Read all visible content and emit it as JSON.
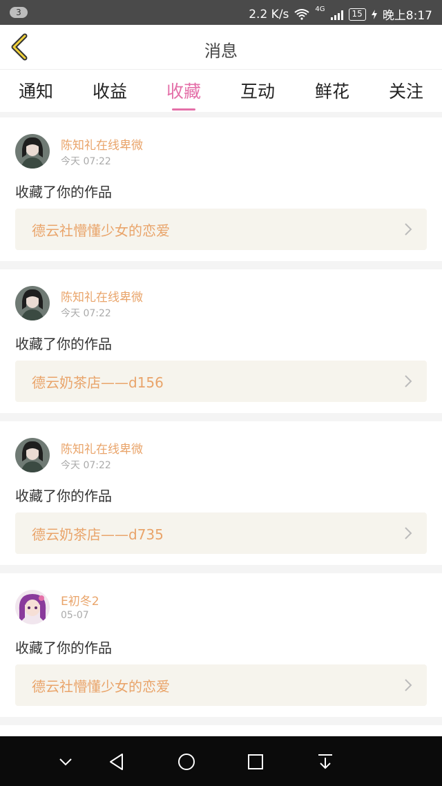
{
  "status_bar": {
    "notification_count": "3",
    "speed": "2.2 K/s",
    "network": "4G",
    "battery": "15",
    "time": "晚上8:17"
  },
  "header": {
    "title": "消息"
  },
  "tabs": [
    {
      "label": "通知"
    },
    {
      "label": "收益"
    },
    {
      "label": "收藏",
      "active": true
    },
    {
      "label": "互动"
    },
    {
      "label": "鲜花"
    },
    {
      "label": "关注"
    }
  ],
  "messages": [
    {
      "user": "陈知礼在线卑微",
      "time": "今天 07:22",
      "action": "收藏了你的作品",
      "work": "德云社懵懂少女的恋爱"
    },
    {
      "user": "陈知礼在线卑微",
      "time": "今天 07:22",
      "action": "收藏了你的作品",
      "work": "德云奶茶店——d156"
    },
    {
      "user": "陈知礼在线卑微",
      "time": "今天 07:22",
      "action": "收藏了你的作品",
      "work": "德云奶茶店——d735"
    },
    {
      "user": "E初冬2",
      "time": "05-07",
      "action": "收藏了你的作品",
      "work": "德云社懵懂少女的恋爱"
    }
  ],
  "colors": {
    "accent_pink": "#e46fa8",
    "name_orange": "#e9a46a"
  }
}
